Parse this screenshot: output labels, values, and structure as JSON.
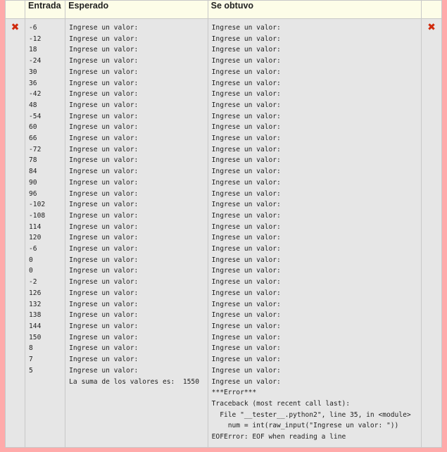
{
  "headers": {
    "mark": "",
    "input": "Entrada",
    "expected": "Esperado",
    "got": "Se obtuvo",
    "mark2": ""
  },
  "status_icon": "cross-icon",
  "status_color": "#d02a0c",
  "background_color": "#ffaaaa",
  "input_lines": [
    "-6",
    "-12",
    "18",
    "-24",
    "30",
    "36",
    "-42",
    "48",
    "-54",
    "60",
    "66",
    "-72",
    "78",
    "84",
    "90",
    "96",
    "-102",
    "-108",
    "114",
    "120",
    "-6",
    "0",
    "0",
    "-2",
    "126",
    "132",
    "138",
    "144",
    "150",
    "8",
    "7",
    "5"
  ],
  "expected_lines": [
    "Ingrese un valor:",
    "Ingrese un valor:",
    "Ingrese un valor:",
    "Ingrese un valor:",
    "Ingrese un valor:",
    "Ingrese un valor:",
    "Ingrese un valor:",
    "Ingrese un valor:",
    "Ingrese un valor:",
    "Ingrese un valor:",
    "Ingrese un valor:",
    "Ingrese un valor:",
    "Ingrese un valor:",
    "Ingrese un valor:",
    "Ingrese un valor:",
    "Ingrese un valor:",
    "Ingrese un valor:",
    "Ingrese un valor:",
    "Ingrese un valor:",
    "Ingrese un valor:",
    "Ingrese un valor:",
    "Ingrese un valor:",
    "Ingrese un valor:",
    "Ingrese un valor:",
    "Ingrese un valor:",
    "Ingrese un valor:",
    "Ingrese un valor:",
    "Ingrese un valor:",
    "Ingrese un valor:",
    "Ingrese un valor:",
    "Ingrese un valor:",
    "Ingrese un valor:",
    "La suma de los valores es:  1550"
  ],
  "got_lines": [
    "Ingrese un valor:",
    "Ingrese un valor:",
    "Ingrese un valor:",
    "Ingrese un valor:",
    "Ingrese un valor:",
    "Ingrese un valor:",
    "Ingrese un valor:",
    "Ingrese un valor:",
    "Ingrese un valor:",
    "Ingrese un valor:",
    "Ingrese un valor:",
    "Ingrese un valor:",
    "Ingrese un valor:",
    "Ingrese un valor:",
    "Ingrese un valor:",
    "Ingrese un valor:",
    "Ingrese un valor:",
    "Ingrese un valor:",
    "Ingrese un valor:",
    "Ingrese un valor:",
    "Ingrese un valor:",
    "Ingrese un valor:",
    "Ingrese un valor:",
    "Ingrese un valor:",
    "Ingrese un valor:",
    "Ingrese un valor:",
    "Ingrese un valor:",
    "Ingrese un valor:",
    "Ingrese un valor:",
    "Ingrese un valor:",
    "Ingrese un valor:",
    "Ingrese un valor:",
    "Ingrese un valor:",
    "***Error***",
    "Traceback (most recent call last):",
    "  File \"__tester__.python2\", line 35, in <module>",
    "    num = int(raw_input(\"Ingrese un valor: \"))",
    "EOFError: EOF when reading a line"
  ]
}
